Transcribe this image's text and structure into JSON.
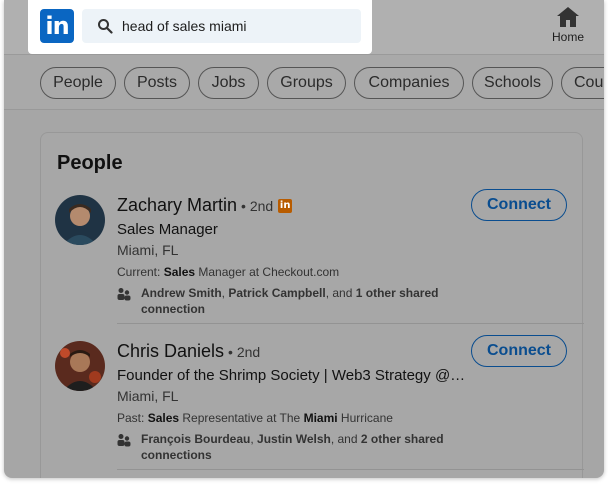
{
  "header": {
    "logo_text": "in",
    "search_value": "head of sales miami",
    "home_label": "Home"
  },
  "filters": [
    "People",
    "Posts",
    "Jobs",
    "Groups",
    "Companies",
    "Schools",
    "Cou"
  ],
  "card": {
    "title": "People",
    "results": [
      {
        "name": "Zachary Martin",
        "degree": "• 2nd",
        "has_premium_badge": true,
        "headline": "Sales Manager",
        "location": "Miami, FL",
        "summary_prefix": "Current: ",
        "summary_bold": "Sales",
        "summary_rest": " Manager at Checkout.com",
        "shared_names": "Andrew Smith",
        "shared_sep1": ", ",
        "shared_name2": "Patrick Campbell",
        "shared_and": ", and ",
        "shared_count": "1 other shared connection",
        "connect_label": "Connect"
      },
      {
        "name": "Chris Daniels",
        "degree": "• 2nd",
        "has_premium_badge": false,
        "headline": "Founder of the Shrimp Society | Web3 Strategy @…",
        "location": "Miami, FL",
        "summary_prefix": "Past: ",
        "summary_bold": "Sales",
        "summary_mid": " Representative at The ",
        "summary_bold2": "Miami",
        "summary_rest": " Hurricane",
        "shared_names": "François Bourdeau",
        "shared_sep1": ", ",
        "shared_name2": "Justin Welsh",
        "shared_and": ", and ",
        "shared_count": "2 other shared connections",
        "connect_label": "Connect"
      }
    ]
  },
  "colors": {
    "brand": "#0a66c2",
    "premium_badge": "#b85c00",
    "connect": "#0a4d8f"
  }
}
